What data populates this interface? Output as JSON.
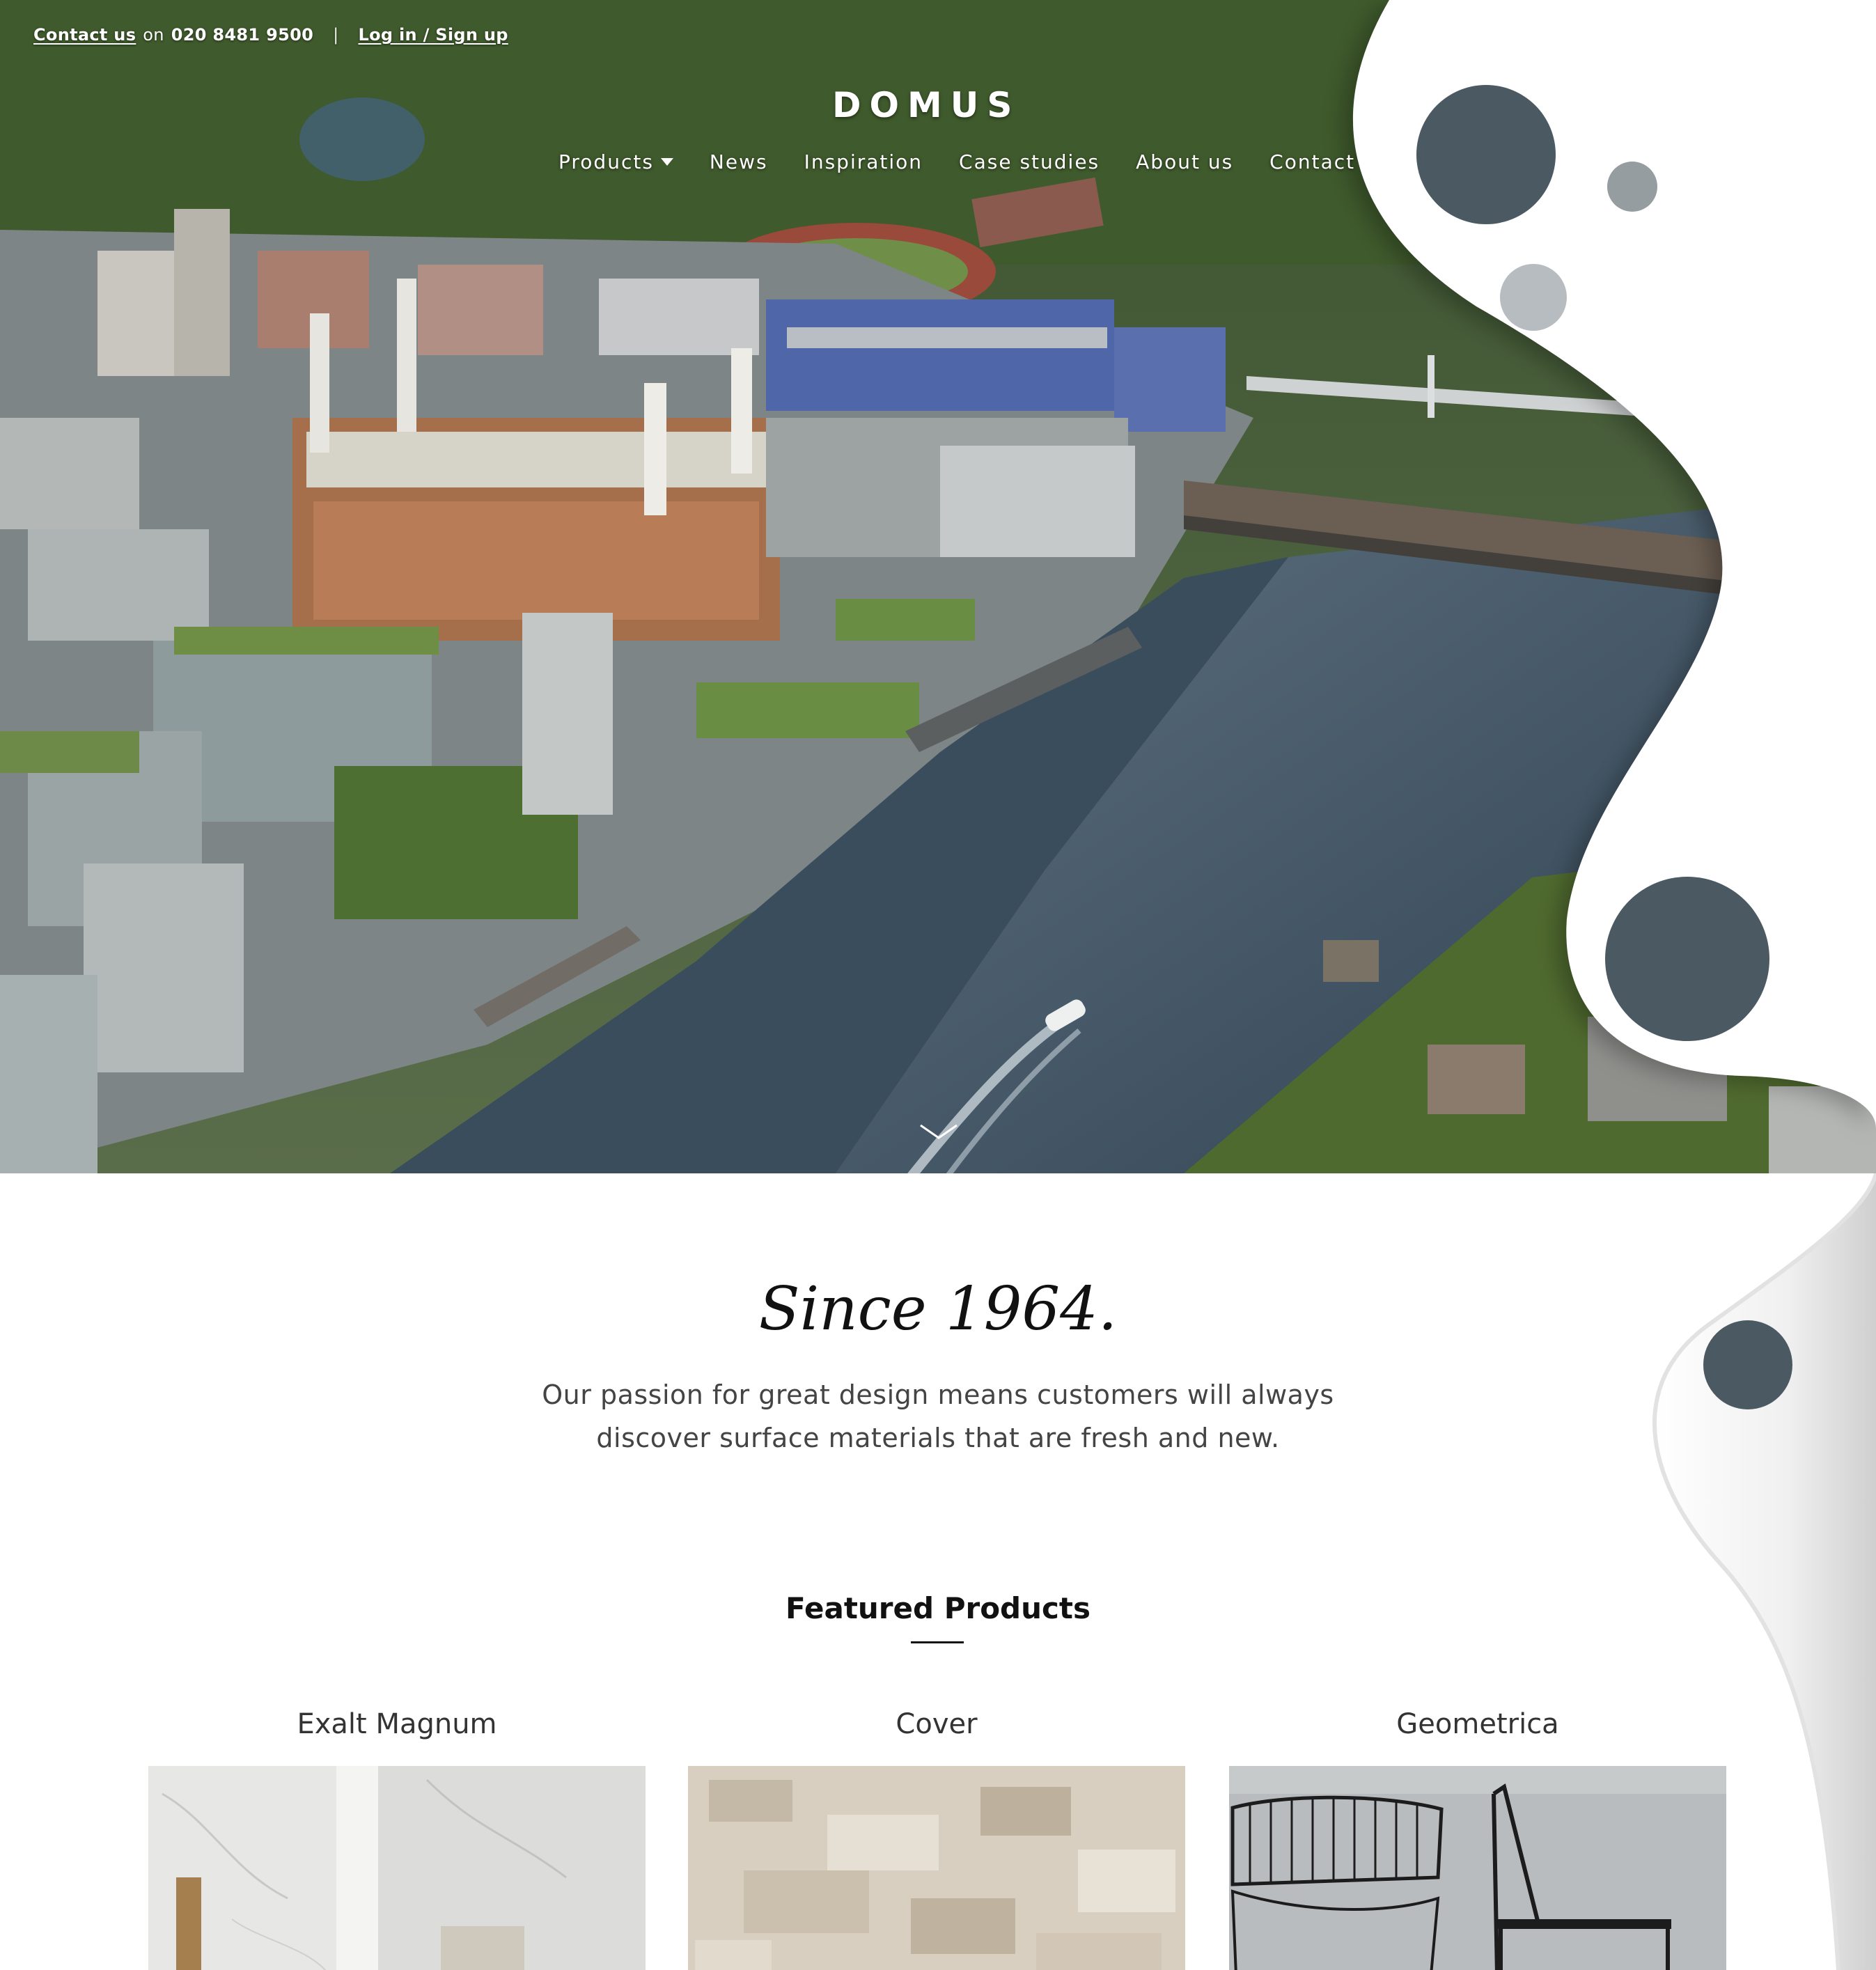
{
  "topbar": {
    "contact_label": "Contact us",
    "on_label": "on",
    "phone": "020 8481 9500",
    "separator": "|",
    "login_label": "Log in / Sign up"
  },
  "brand": {
    "logo": "DOMUS"
  },
  "nav": {
    "products": "Products",
    "news": "News",
    "inspiration": "Inspiration",
    "case_studies": "Case studies",
    "about": "About us",
    "contact": "Contact"
  },
  "hero": {
    "image": "aerial-photo-riverside-development-power-station-bridges",
    "scroll_icon": "chevron-down-icon"
  },
  "intro": {
    "since": "Since 1964.",
    "line1": "Our passion for great design means customers will always",
    "line2": "discover surface materials that are fresh and new."
  },
  "featured": {
    "title": "Featured Products",
    "products": [
      {
        "name": "Exalt Magnum",
        "image": "white-marble-tile-wall"
      },
      {
        "name": "Cover",
        "image": "beige-camouflage-texture"
      },
      {
        "name": "Geometrica",
        "image": "wire-chairs-grey-wall"
      }
    ]
  },
  "colors": {
    "dot_dark": "#4a5962",
    "dot_mid": "#959da1",
    "dot_light": "#b6bcbf",
    "text_dark": "#111111",
    "text_body": "#444444"
  }
}
